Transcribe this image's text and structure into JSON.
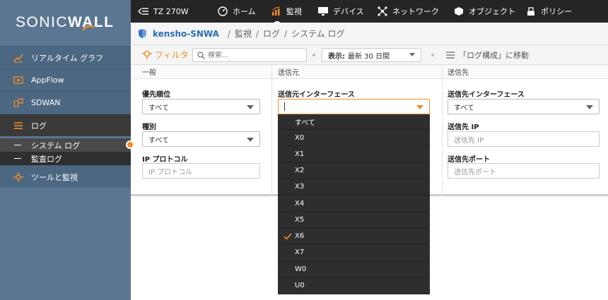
{
  "brand": {
    "logo_text_a": "SONIC",
    "logo_text_b": "WALL"
  },
  "sidebar": {
    "items": [
      {
        "label": "リアルタイム グラフ",
        "icon": "chart-line-icon"
      },
      {
        "label": "AppFlow",
        "icon": "appflow-icon"
      },
      {
        "label": "SDWAN",
        "icon": "sdwan-icon"
      },
      {
        "label": "ログ",
        "icon": "list-icon"
      },
      {
        "label": "ツールと監視",
        "icon": "tools-icon"
      }
    ],
    "sub_items": [
      {
        "label": "システム ログ"
      },
      {
        "label": "監査ログ"
      }
    ]
  },
  "topbar": {
    "device": "TZ 270W",
    "items": [
      {
        "label": "ホーム",
        "icon": "dashboard-icon"
      },
      {
        "label": "監視",
        "icon": "monitor-chart-icon"
      },
      {
        "label": "デバイス",
        "icon": "device-icon"
      },
      {
        "label": "ネットワーク",
        "icon": "network-icon"
      },
      {
        "label": "オブジェクト",
        "icon": "object-icon"
      },
      {
        "label": "ポリシー",
        "icon": "policy-icon"
      }
    ]
  },
  "breadcrumb": {
    "device": "kensho-SNWA",
    "parts": [
      "監視",
      "ログ",
      "システム ログ"
    ]
  },
  "toolbar": {
    "filter_label": "フィルタ",
    "search_placeholder": "検索...",
    "date_label": "表示:",
    "date_value": "最新 30 日間",
    "log_config": "「ログ構成」に移動"
  },
  "panel": {
    "columns": [
      "一般",
      "送信元",
      "送信先"
    ],
    "general": {
      "priority_label": "優先順位",
      "priority_value": "すべて",
      "type_label": "種別",
      "type_value": "すべて",
      "protocol_label": "IP プロトコル",
      "protocol_placeholder": "IP プロトコル"
    },
    "source": {
      "iface_label": "送信元インターフェース"
    },
    "destination": {
      "iface_label": "送信先インターフェース",
      "iface_value": "すべて",
      "ip_label": "送信先 IP",
      "ip_placeholder": "送信先 IP",
      "port_label": "送信先ポート",
      "port_placeholder": "送信先ポート"
    }
  },
  "dropdown": {
    "options": [
      "すべて",
      "X0",
      "X1",
      "X2",
      "X3",
      "X4",
      "X5",
      "X6",
      "X7",
      "W0",
      "U0"
    ],
    "checked": "X6"
  },
  "colors": {
    "accent": "#f28c28",
    "sidebar": "#5b7692",
    "topbar": "#252525",
    "link": "#2f6db5"
  }
}
